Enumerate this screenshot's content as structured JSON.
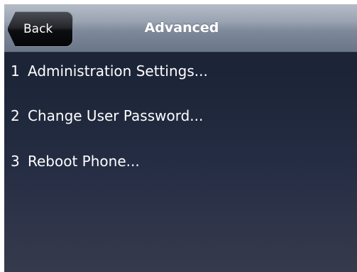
{
  "header": {
    "back_label": "Back",
    "title": "Advanced"
  },
  "menu": {
    "items": [
      {
        "number": "1",
        "label": "Administration Settings..."
      },
      {
        "number": "2",
        "label": "Change User Password..."
      },
      {
        "number": "3",
        "label": "Reboot Phone..."
      }
    ]
  },
  "colors": {
    "text": "#ffffff",
    "background_top": "#1a2133",
    "background_bottom": "#363a4c",
    "title_bar": "#9aa4b2",
    "back_button": "#0c0d10"
  }
}
